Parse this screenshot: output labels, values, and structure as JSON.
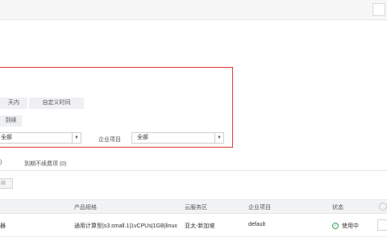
{
  "filter": {
    "time_chip_partial": "天内",
    "custom_time_chip": "自定义时间",
    "status_chip_partial": "到续",
    "select_left_value": "全部",
    "enterprise_project_label": "企业项目",
    "enterprise_project_value": "全部"
  },
  "tabs": {
    "tab1_partial": ")",
    "tab2": "到期不续费项 (0)"
  },
  "toolbar": {
    "button_partial": "续"
  },
  "table": {
    "headers": [
      "产品规格",
      "云服务区",
      "企业项目",
      "状态"
    ],
    "row": {
      "name_partial": "器",
      "spec": "通用计算型|s3.small.1|1vCPUs|1GB|linux",
      "region": "亚太-新加坡",
      "project": "default",
      "status": "使用中"
    }
  },
  "colors": {
    "highlight_border": "#e03a3a",
    "status_ok": "#3aa35b"
  }
}
